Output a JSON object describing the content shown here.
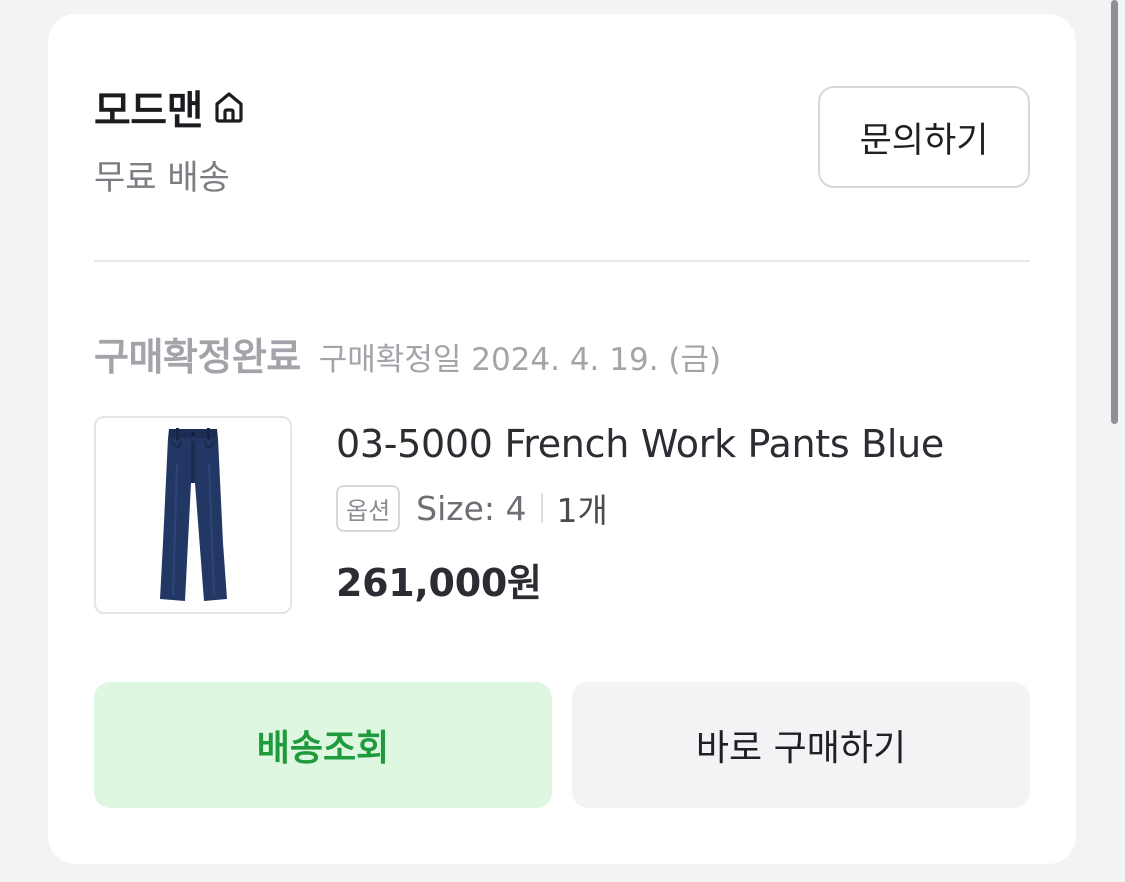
{
  "seller": {
    "name": "모드맨",
    "icon": "home-icon",
    "shipping": "무료 배송",
    "inquiry_label": "문의하기"
  },
  "order": {
    "status": "구매확정완료",
    "date_text": "구매확정일 2024. 4. 19. (금)"
  },
  "product": {
    "name": "03-5000 French Work Pants Blue",
    "option_badge": "옵션",
    "size": "Size: 4",
    "quantity": "1개",
    "price": "261,000원"
  },
  "actions": {
    "track_label": "배송조회",
    "buy_again_label": "바로 구매하기"
  },
  "colors": {
    "accent_green": "#1f9b3d",
    "accent_green_bg": "#def7e1",
    "muted_text": "#a2a4a9"
  }
}
